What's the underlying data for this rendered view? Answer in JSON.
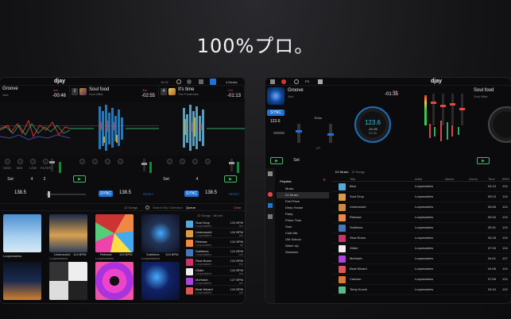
{
  "headline": "100%プロ。",
  "left": {
    "logo": "djay",
    "status_time": "16:02",
    "devices_label": "4 Decks",
    "decks": [
      {
        "num": "",
        "title": "Groove",
        "artist": "Joel",
        "key": "Am",
        "time": "-00:46",
        "bpm": "138.5",
        "bpm_target": "138.5"
      },
      {
        "num": "2",
        "title": "Soul food",
        "artist": "Soul Mike",
        "key": "Am",
        "time": "-02:55",
        "bpm": "138.5"
      },
      {
        "num": "4",
        "title": "It's time",
        "artist": "The Footnotes",
        "key": "Cm",
        "time": "-01:13",
        "bpm": "138.5"
      }
    ],
    "controls": {
      "set": "Set",
      "sync": "SYNC",
      "reset": "RESET",
      "cue_nums": [
        "4",
        "2",
        "4"
      ],
      "eq_labels": [
        "HIGH",
        "MID",
        "LOW",
        "FILTER"
      ]
    },
    "library": {
      "songs_count": "12 Songs",
      "search_placeholder": "Search My Collection",
      "queue_tab": "Queue",
      "queue_meta": "12 Songs · 66 min",
      "clear": "Clear",
      "tiles": [
        {
          "title": "",
          "artist": "Loopmasters",
          "bpm": "",
          "key": ""
        },
        {
          "title": "Underworld",
          "artist": "Loopmasters",
          "bpm": "124 BPM",
          "key": "Am"
        },
        {
          "title": "Release",
          "artist": "Loopmasters",
          "bpm": "124 BPM",
          "key": "Ab"
        },
        {
          "title": "Sublimes",
          "artist": "Loopmasters",
          "bpm": "124 BPM",
          "key": "Dm"
        }
      ],
      "queue": [
        {
          "title": "Soul Drop",
          "artist": "Loopmasters",
          "bpm": "124 BPM",
          "key": "Am"
        },
        {
          "title": "Underworld",
          "artist": "Loopmasters",
          "bpm": "124 BPM",
          "key": "Am"
        },
        {
          "title": "Release",
          "artist": "Loopmasters",
          "bpm": "124 BPM",
          "key": "Ab"
        },
        {
          "title": "Sublimes",
          "artist": "Loopmasters",
          "bpm": "124 BPM",
          "key": "Dm"
        },
        {
          "title": "Slow Burns",
          "artist": "Loopmasters",
          "bpm": "124 BPM",
          "key": "Em"
        },
        {
          "title": "Glider",
          "artist": "Loopmasters",
          "bpm": "124 BPM",
          "key": "Am"
        },
        {
          "title": "McHatch",
          "artist": "Loopmasters",
          "bpm": "127 BPM",
          "key": "Am"
        },
        {
          "title": "Beat Wizard",
          "artist": "Loopmasters",
          "bpm": "124 BPM",
          "key": "Am"
        }
      ]
    }
  },
  "right": {
    "logo": "djay",
    "fx_label": "FX",
    "decks": [
      {
        "title": "Groove",
        "artist": "Joel",
        "key": "Am",
        "time": "-01:35",
        "bpm": "123.6"
      },
      {
        "title": "Soul food",
        "artist": "Soul Mike",
        "key": "Am",
        "time": "",
        "bpm": ""
      }
    ],
    "platter_bpm": "123.6",
    "platter_time_a": "-01:35",
    "platter_time_b": "02:45",
    "sync": "SYNC",
    "echo_label": "Echo",
    "lp_label": "LP",
    "set": "Set",
    "library": {
      "playlists_title": "Playlists",
      "tab_title": "DJ Music",
      "tab_count": "12 Songs",
      "columns": [
        "Title",
        "Artist",
        "Album",
        "Genre",
        "Time",
        "BPM"
      ],
      "playlists": [
        "Music",
        "DJ Music",
        "Feel Pace",
        "Deep House",
        "Party",
        "Prime Time",
        "Soul",
        "Club Mix",
        "Old School",
        "Warm Up",
        "Sessions"
      ],
      "tracks": [
        {
          "title": "Blue",
          "artist": "Loopmasters",
          "time": "04:13",
          "bpm": "124"
        },
        {
          "title": "Soul Drop",
          "artist": "Loopmasters",
          "time": "05:13",
          "bpm": "124"
        },
        {
          "title": "Underworld",
          "artist": "Loopmasters",
          "time": "06:06",
          "bpm": "124"
        },
        {
          "title": "Release",
          "artist": "Loopmasters",
          "time": "05:44",
          "bpm": "124"
        },
        {
          "title": "Sublimes",
          "artist": "Loopmasters",
          "time": "05:31",
          "bpm": "124"
        },
        {
          "title": "Slow Burns",
          "artist": "Loopmasters",
          "time": "04:18",
          "bpm": "124"
        },
        {
          "title": "Glider",
          "artist": "Loopmasters",
          "time": "07:33",
          "bpm": "124"
        },
        {
          "title": "McHatch",
          "artist": "Loopmasters",
          "time": "04:01",
          "bpm": "127"
        },
        {
          "title": "Beat Wizard",
          "artist": "Loopmasters",
          "time": "04:06",
          "bpm": "124"
        },
        {
          "title": "Calcium",
          "artist": "Loopmasters",
          "time": "07:06",
          "bpm": "124"
        },
        {
          "title": "Temp Knock",
          "artist": "Loopmasters",
          "time": "04:24",
          "bpm": "124"
        }
      ]
    }
  },
  "colors": {
    "accent": "#1f73d8",
    "play": "#3fbf5a",
    "key": "#e05050",
    "bpm": "#2ec4e8"
  }
}
